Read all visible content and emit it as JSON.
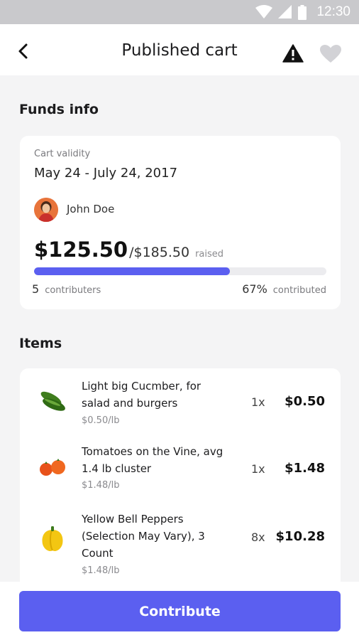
{
  "status_bar": {
    "time": "12:30",
    "icons": [
      "wifi-icon",
      "signal-icon",
      "battery-icon"
    ]
  },
  "header": {
    "title": "Published cart",
    "back_icon": "back-arrow-icon",
    "warning_icon": "warning-icon",
    "favorite_icon": "heart-icon"
  },
  "funds": {
    "section_title": "Funds info",
    "validity_label": "Cart validity",
    "validity_dates": "May 24 - July 24, 2017",
    "owner_name": "John Doe",
    "raised_amount": "$125.50",
    "goal_amount": "/$185.50",
    "raised_label": "raised",
    "progress_fraction": 0.67,
    "contributors_count": "5",
    "contributors_label": "contributers",
    "contributed_percent": "67%",
    "contributed_label": "contributed"
  },
  "items": {
    "section_title": "Items",
    "list": [
      {
        "name": "Light big Cucmber, for salad and burgers",
        "unit_price": "$0.50/lb",
        "quantity": "1x",
        "price": "$0.50",
        "image": "cucumber-image"
      },
      {
        "name": "Tomatoes on the Vine, avg 1.4 lb cluster",
        "unit_price": "$1.48/lb",
        "quantity": "1x",
        "price": "$1.48",
        "image": "tomatoes-image"
      },
      {
        "name": "Yellow Bell Peppers (Selection May Vary), 3 Count",
        "unit_price": "$1.48/lb",
        "quantity": "8x",
        "price": "$10.28",
        "image": "yellow-pepper-image"
      }
    ]
  },
  "actions": {
    "contribute_label": "Contribute"
  },
  "colors": {
    "accent": "#5b5ff0",
    "background": "#f4f4f5",
    "card": "#ffffff",
    "status_bar": "#c9c9cc"
  }
}
